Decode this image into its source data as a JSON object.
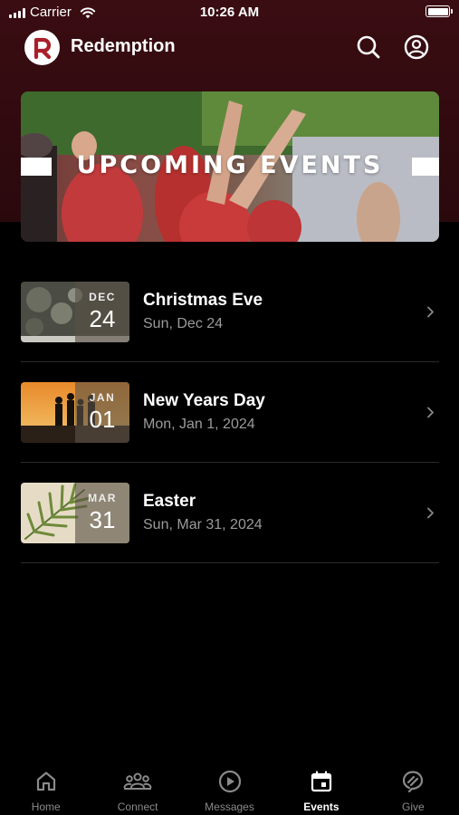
{
  "status_bar": {
    "carrier": "Carrier",
    "time": "10:26 AM"
  },
  "header": {
    "app_name": "Redemption",
    "logo_letter": "R"
  },
  "banner": {
    "title": "UPCOMING EVENTS"
  },
  "events": [
    {
      "title": "Christmas Eve",
      "date": "Sun, Dec 24",
      "month": "DEC",
      "day": "24"
    },
    {
      "title": "New Years Day",
      "date": "Mon, Jan 1, 2024",
      "month": "JAN",
      "day": "01"
    },
    {
      "title": "Easter",
      "date": "Sun, Mar 31, 2024",
      "month": "MAR",
      "day": "31"
    }
  ],
  "tabs": [
    {
      "label": "Home",
      "icon": "home-icon",
      "active": false
    },
    {
      "label": "Connect",
      "icon": "people-icon",
      "active": false
    },
    {
      "label": "Messages",
      "icon": "play-circle-icon",
      "active": false
    },
    {
      "label": "Events",
      "icon": "calendar-icon",
      "active": true
    },
    {
      "label": "Give",
      "icon": "give-icon",
      "active": false
    }
  ],
  "colors": {
    "brand": "#a8202b",
    "header_bg": "#3a0d12",
    "muted_text": "#9b9b9b"
  }
}
